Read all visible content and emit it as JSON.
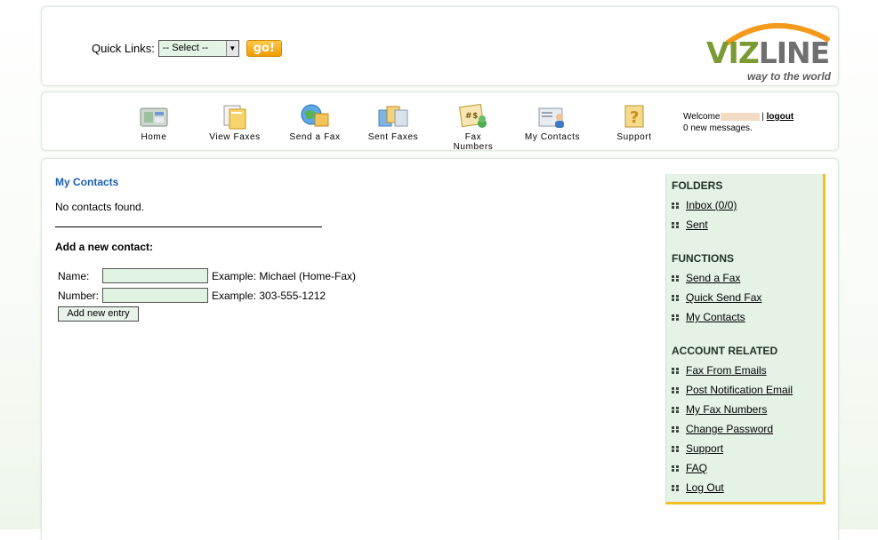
{
  "top": {
    "quick_links_label": "Quick Links:",
    "select_value": "-- Select --",
    "go_label": "go!",
    "logo_part1": "VIZ",
    "logo_part2": "LINE",
    "tagline": "way to the world"
  },
  "nav": {
    "items": [
      {
        "label": "Home",
        "icon": "home-icon"
      },
      {
        "label": "View Faxes",
        "icon": "view-faxes-icon"
      },
      {
        "label": "Send a Fax",
        "icon": "send-fax-icon"
      },
      {
        "label": "Sent Faxes",
        "icon": "sent-faxes-icon"
      },
      {
        "label": "Fax Numbers",
        "icon": "fax-numbers-icon"
      },
      {
        "label": "My Contacts",
        "icon": "contacts-icon"
      },
      {
        "label": "Support",
        "icon": "support-icon"
      }
    ],
    "welcome_prefix": "Welcome",
    "logout_label": "logout",
    "messages": "0 new messages."
  },
  "main": {
    "title": "My Contacts",
    "no_contacts": "No contacts found.",
    "add_heading": "Add a new contact:",
    "name_label": "Name:",
    "name_example": "Example: Michael (Home-Fax)",
    "number_label": "Number:",
    "number_example": "Example: 303-555-1212",
    "add_button": "Add new entry"
  },
  "sidebar": {
    "folders_heading": "FOLDERS",
    "folders": [
      "Inbox (0/0)",
      "Sent"
    ],
    "functions_heading": "FUNCTIONS",
    "functions": [
      "Send a Fax",
      "Quick Send Fax",
      "My Contacts"
    ],
    "account_heading": "ACCOUNT RELATED",
    "account": [
      "Fax From Emails",
      "Post Notification Email",
      "My Fax Numbers",
      "Change Password",
      "Support",
      "FAQ",
      "Log Out"
    ]
  },
  "colors": {
    "accent_blue": "#1c5fb0",
    "sidebar_bg": "#e5f2e6",
    "sidebar_border": "#f0c020",
    "go_button": "#f09b00"
  }
}
